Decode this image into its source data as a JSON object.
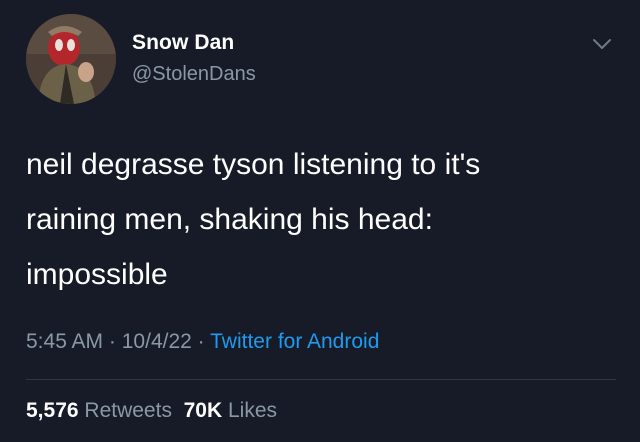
{
  "tweet": {
    "author": {
      "display_name": "Snow Dan",
      "handle": "@StolenDans"
    },
    "text": "neil degrasse tyson listening to it's\nraining men, shaking his head:\nimpossible",
    "meta": {
      "time": "5:45 AM",
      "separator": "·",
      "date": "10/4/22",
      "source": "Twitter for Android"
    },
    "stats": {
      "retweets_count": "5,576",
      "retweets_label": "Retweets",
      "likes_count": "70K",
      "likes_label": "Likes"
    },
    "icons": {
      "menu": "chevron-down-icon",
      "avatar": "avatar-image"
    }
  },
  "colors": {
    "background": "#161b27",
    "text_primary": "#ffffff",
    "text_secondary": "#8a98a5",
    "accent": "#1d9bf0"
  }
}
